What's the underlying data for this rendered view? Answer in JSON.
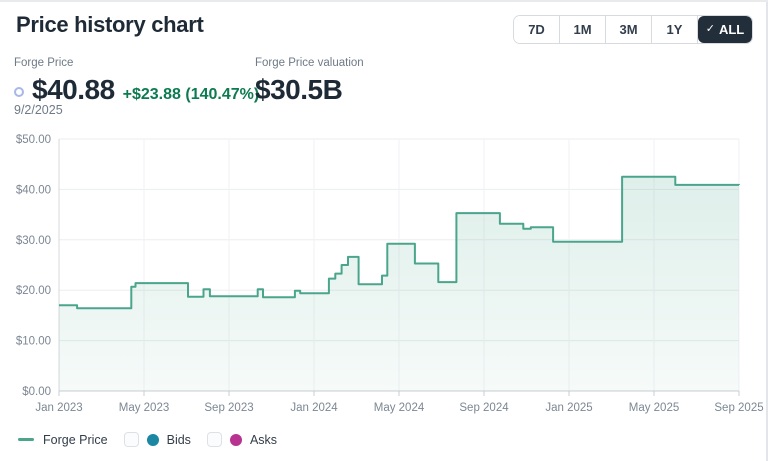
{
  "header": {
    "title": "Price history chart",
    "check_glyph": "✓",
    "range_buttons": [
      {
        "label": "7D",
        "active": false
      },
      {
        "label": "1M",
        "active": false
      },
      {
        "label": "3M",
        "active": false
      },
      {
        "label": "1Y",
        "active": false
      },
      {
        "label": "ALL",
        "active": true
      }
    ]
  },
  "stats": {
    "price_label": "Forge Price",
    "price": "$40.88",
    "change": "+$23.88 (140.47%)",
    "date": "9/2/2025",
    "valuation_label": "Forge Price valuation",
    "valuation": "$30.5B"
  },
  "legend": {
    "items": [
      {
        "label": "Forge Price",
        "type": "line"
      },
      {
        "label": "Bids",
        "type": "checkbox-dot"
      },
      {
        "label": "Asks",
        "type": "checkbox-dot"
      }
    ]
  },
  "colors": {
    "accent_line": "#4aa58b",
    "green_text": "#0c7b4f",
    "bids": "#1b87a3",
    "asks": "#b8338f",
    "dark_button": "#232e3b",
    "price_ring": "#a9b7ea"
  },
  "chart_data": {
    "type": "area",
    "title": "Forge Price history",
    "xlabel": "",
    "ylabel": "",
    "step": "after",
    "grid": true,
    "legend_position": "bottom",
    "ylim": [
      0,
      50
    ],
    "xlim_months": [
      0,
      32
    ],
    "x_start": "Jan 2023",
    "yticks": [
      {
        "v": 0,
        "label": "$0.00"
      },
      {
        "v": 10,
        "label": "$10.00"
      },
      {
        "v": 20,
        "label": "$20.00"
      },
      {
        "v": 30,
        "label": "$30.00"
      },
      {
        "v": 40,
        "label": "$40.00"
      },
      {
        "v": 50,
        "label": "$50.00"
      }
    ],
    "xticks": [
      {
        "m": 0,
        "label": "Jan 2023"
      },
      {
        "m": 4,
        "label": "May 2023"
      },
      {
        "m": 8,
        "label": "Sep 2023"
      },
      {
        "m": 12,
        "label": "Jan 2024"
      },
      {
        "m": 16,
        "label": "May 2024"
      },
      {
        "m": 20,
        "label": "Sep 2024"
      },
      {
        "m": 24,
        "label": "Jan 2025"
      },
      {
        "m": 28,
        "label": "May 2025"
      },
      {
        "m": 32,
        "label": "Sep 2025"
      }
    ],
    "series": [
      {
        "name": "Forge Price",
        "color": "#4aa58b",
        "points_months_price": [
          [
            0,
            17.0
          ],
          [
            0.85,
            16.4
          ],
          [
            3.4,
            20.7
          ],
          [
            3.6,
            21.4
          ],
          [
            6.07,
            18.7
          ],
          [
            6.8,
            20.2
          ],
          [
            7.1,
            18.8
          ],
          [
            9.35,
            20.2
          ],
          [
            9.6,
            18.6
          ],
          [
            11.1,
            19.9
          ],
          [
            11.35,
            19.4
          ],
          [
            12.7,
            22.3
          ],
          [
            13.0,
            23.3
          ],
          [
            13.3,
            25.0
          ],
          [
            13.6,
            26.6
          ],
          [
            14.1,
            21.2
          ],
          [
            15.2,
            22.9
          ],
          [
            15.45,
            29.2
          ],
          [
            16.75,
            25.3
          ],
          [
            17.85,
            21.6
          ],
          [
            18.7,
            35.3
          ],
          [
            20.75,
            33.2
          ],
          [
            21.85,
            32.2
          ],
          [
            22.2,
            32.5
          ],
          [
            23.25,
            29.6
          ],
          [
            26.5,
            42.5
          ],
          [
            29.0,
            40.9
          ],
          [
            32.0,
            40.88
          ]
        ]
      }
    ]
  }
}
